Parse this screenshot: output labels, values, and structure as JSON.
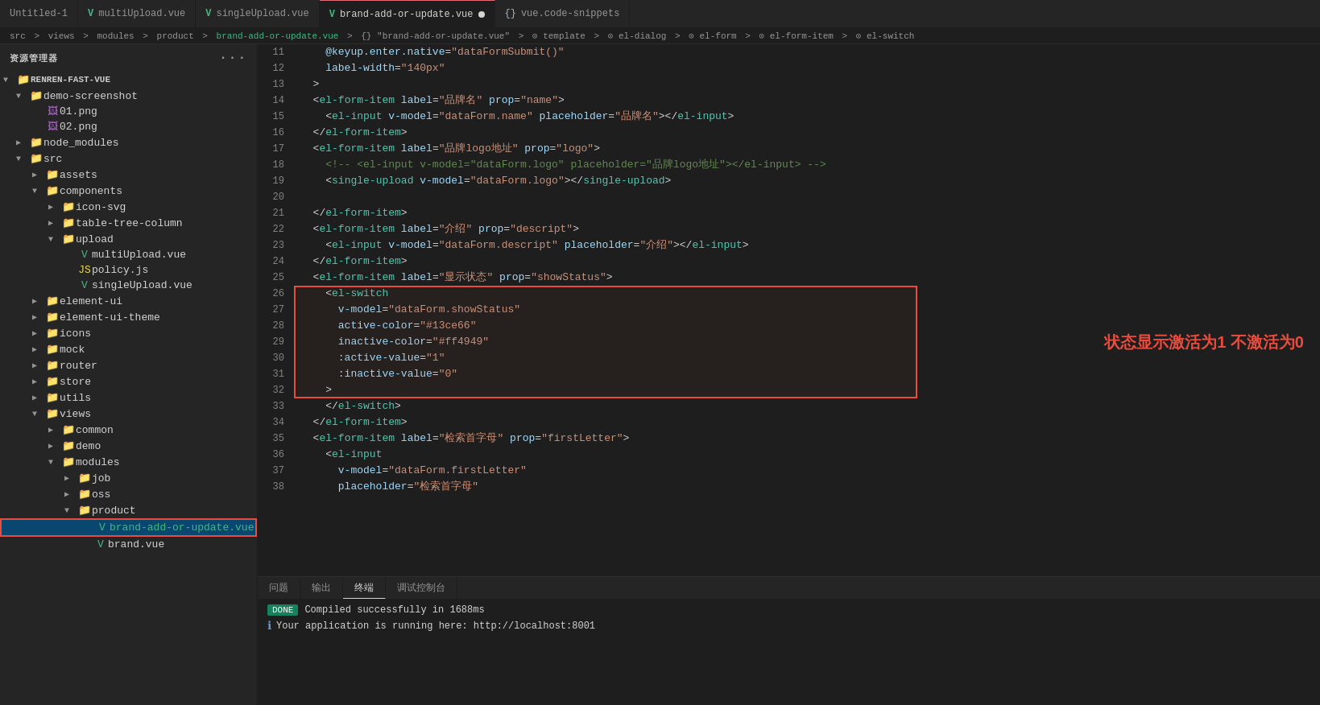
{
  "tabs": [
    {
      "id": "untitled",
      "label": "Untitled-1",
      "icon": "plain",
      "active": false
    },
    {
      "id": "multiUpload",
      "label": "multiUpload.vue",
      "icon": "vue",
      "active": false
    },
    {
      "id": "singleUpload",
      "label": "singleUpload.vue",
      "icon": "vue",
      "active": false
    },
    {
      "id": "brandAddOrUpdate",
      "label": "brand-add-or-update.vue",
      "icon": "vue",
      "active": true,
      "dot": true
    },
    {
      "id": "vueSnippets",
      "label": "vue.code-snippets",
      "icon": "snippet",
      "active": false
    }
  ],
  "breadcrumb": "src > views > modules > product > brand-add-or-update.vue > {} \"brand-add-or-update.vue\" > ⊙ template > ⊙ el-dialog > ⊙ el-form > ⊙ el-form-item > ⊙ el-switch",
  "sidebar": {
    "title": "资源管理器",
    "root": "RENREN-FAST-VUE",
    "items": [
      {
        "id": "demo-screenshot",
        "label": "demo-screenshot",
        "type": "folder",
        "expanded": true,
        "depth": 1
      },
      {
        "id": "01png",
        "label": "01.png",
        "type": "png",
        "depth": 2
      },
      {
        "id": "02png",
        "label": "02.png",
        "type": "png",
        "depth": 2
      },
      {
        "id": "node_modules",
        "label": "node_modules",
        "type": "folder",
        "expanded": false,
        "depth": 1
      },
      {
        "id": "src",
        "label": "src",
        "type": "folder",
        "expanded": true,
        "depth": 1
      },
      {
        "id": "assets",
        "label": "assets",
        "type": "folder",
        "expanded": false,
        "depth": 2
      },
      {
        "id": "components",
        "label": "components",
        "type": "folder",
        "expanded": true,
        "depth": 2
      },
      {
        "id": "icon-svg",
        "label": "icon-svg",
        "type": "folder",
        "expanded": false,
        "depth": 3
      },
      {
        "id": "table-tree-column",
        "label": "table-tree-column",
        "type": "folder",
        "expanded": false,
        "depth": 3
      },
      {
        "id": "upload",
        "label": "upload",
        "type": "folder",
        "expanded": true,
        "depth": 3
      },
      {
        "id": "multiUpload",
        "label": "multiUpload.vue",
        "type": "vue",
        "depth": 4
      },
      {
        "id": "policy",
        "label": "policy.js",
        "type": "js",
        "depth": 4
      },
      {
        "id": "singleUpload",
        "label": "singleUpload.vue",
        "type": "vue",
        "depth": 4
      },
      {
        "id": "element-ui",
        "label": "element-ui",
        "type": "folder",
        "expanded": false,
        "depth": 2
      },
      {
        "id": "element-ui-theme",
        "label": "element-ui-theme",
        "type": "folder",
        "expanded": false,
        "depth": 2
      },
      {
        "id": "icons",
        "label": "icons",
        "type": "folder",
        "expanded": false,
        "depth": 2
      },
      {
        "id": "mock",
        "label": "mock",
        "type": "folder",
        "expanded": false,
        "depth": 2
      },
      {
        "id": "router",
        "label": "router",
        "type": "folder",
        "expanded": false,
        "depth": 2
      },
      {
        "id": "store",
        "label": "store",
        "type": "folder",
        "expanded": false,
        "depth": 2
      },
      {
        "id": "utils",
        "label": "utils",
        "type": "folder",
        "expanded": false,
        "depth": 2
      },
      {
        "id": "views",
        "label": "views",
        "type": "folder",
        "expanded": true,
        "depth": 2
      },
      {
        "id": "common",
        "label": "common",
        "type": "folder",
        "expanded": false,
        "depth": 3
      },
      {
        "id": "demo",
        "label": "demo",
        "type": "folder",
        "expanded": false,
        "depth": 3
      },
      {
        "id": "modules",
        "label": "modules",
        "type": "folder",
        "expanded": true,
        "depth": 3
      },
      {
        "id": "job",
        "label": "job",
        "type": "folder",
        "expanded": false,
        "depth": 4
      },
      {
        "id": "oss",
        "label": "oss",
        "type": "folder",
        "expanded": false,
        "depth": 4
      },
      {
        "id": "product",
        "label": "product",
        "type": "folder",
        "expanded": true,
        "depth": 4
      },
      {
        "id": "brandAddOrUpdateFile",
        "label": "brand-add-or-update.vue",
        "type": "vue",
        "depth": 5,
        "selected": true
      },
      {
        "id": "brandFile",
        "label": "brand.vue",
        "type": "vue",
        "depth": 5
      }
    ]
  },
  "code_lines": [
    {
      "num": 11,
      "content": "    @keyup.enter.native=\"dataFormSubmit()\""
    },
    {
      "num": 12,
      "content": "    label-width=\"140px\""
    },
    {
      "num": 13,
      "content": "  >"
    },
    {
      "num": 14,
      "content": "  <el-form-item label=\"品牌名\" prop=\"name\">"
    },
    {
      "num": 15,
      "content": "    <el-input v-model=\"dataForm.name\" placeholder=\"品牌名\"></el-input>"
    },
    {
      "num": 16,
      "content": "  </el-form-item>"
    },
    {
      "num": 17,
      "content": "  <el-form-item label=\"品牌logo地址\" prop=\"logo\">"
    },
    {
      "num": 18,
      "content": "    <!-- <el-input v-model=\"dataForm.logo\" placeholder=\"品牌logo地址\"></el-input> -->"
    },
    {
      "num": 19,
      "content": "    <single-upload v-model=\"dataForm.logo\"></single-upload>"
    },
    {
      "num": 20,
      "content": ""
    },
    {
      "num": 21,
      "content": "  </el-form-item>"
    },
    {
      "num": 22,
      "content": "  <el-form-item label=\"介绍\" prop=\"descript\">"
    },
    {
      "num": 23,
      "content": "    <el-input v-model=\"dataForm.descript\" placeholder=\"介绍\"></el-input>"
    },
    {
      "num": 24,
      "content": "  </el-form-item>"
    },
    {
      "num": 25,
      "content": "  <el-form-item label=\"显示状态\" prop=\"showStatus\">"
    },
    {
      "num": 26,
      "content": "    <el-switch",
      "highlight": true
    },
    {
      "num": 27,
      "content": "      v-model=\"dataForm.showStatus\"",
      "highlight": true
    },
    {
      "num": 28,
      "content": "      active-color=\"#13ce66\"",
      "highlight": true
    },
    {
      "num": 29,
      "content": "      inactive-color=\"#ff4949\"",
      "highlight": true
    },
    {
      "num": 30,
      "content": "      :active-value=\"1\"",
      "highlight": true
    },
    {
      "num": 31,
      "content": "      :inactive-value=\"0\"",
      "highlight": true
    },
    {
      "num": 32,
      "content": "    >",
      "highlight": true
    },
    {
      "num": 33,
      "content": "    </el-switch>"
    },
    {
      "num": 34,
      "content": "  </el-form-item>"
    },
    {
      "num": 35,
      "content": "  <el-form-item label=\"检索首字母\" prop=\"firstLetter\">"
    },
    {
      "num": 36,
      "content": "    <el-input"
    },
    {
      "num": 37,
      "content": "      v-model=\"dataForm.firstLetter\""
    },
    {
      "num": 38,
      "content": "      placeholder=\"检索首字母\""
    }
  ],
  "annotation_text": "状态显示激活为1  不激活为0",
  "bottom_panel": {
    "tabs": [
      "问题",
      "输出",
      "终端",
      "调试控制台"
    ],
    "active_tab": "终端",
    "done_label": "DONE",
    "done_text": "Compiled successfully in 1688ms",
    "info_text": "Your application is running here: http://localhost:8001"
  }
}
